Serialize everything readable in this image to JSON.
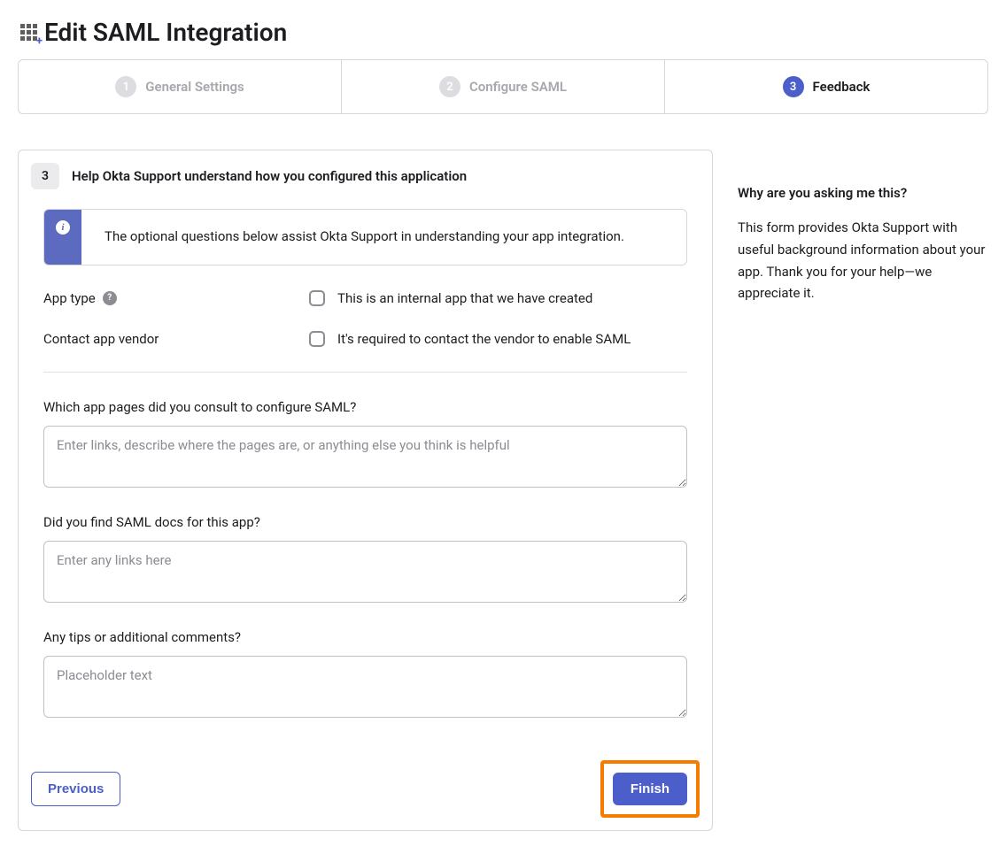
{
  "page": {
    "title": "Edit SAML Integration"
  },
  "wizard": {
    "steps": [
      {
        "num": "1",
        "label": "General Settings"
      },
      {
        "num": "2",
        "label": "Configure SAML"
      },
      {
        "num": "3",
        "label": "Feedback"
      }
    ]
  },
  "section": {
    "num": "3",
    "title": "Help Okta Support understand how you configured this application"
  },
  "info": {
    "text": "The optional questions below assist Okta Support in understanding your app integration."
  },
  "fields": {
    "app_type": {
      "label": "App type",
      "checkbox_label": "This is an internal app that we have created"
    },
    "contact_vendor": {
      "label": "Contact app vendor",
      "checkbox_label": "It's required to contact the vendor to enable SAML"
    },
    "pages_consulted": {
      "label": "Which app pages did you consult to configure SAML?",
      "placeholder": "Enter links, describe where the pages are, or anything else you think is helpful"
    },
    "saml_docs": {
      "label": "Did you find SAML docs for this app?",
      "placeholder": "Enter any links here"
    },
    "tips": {
      "label": "Any tips or additional comments?",
      "placeholder": "Placeholder text"
    }
  },
  "buttons": {
    "previous": "Previous",
    "finish": "Finish"
  },
  "sidebar": {
    "title": "Why are you asking me this?",
    "text": "This form provides Okta Support with useful background information about your app. Thank you for your help—we appreciate it."
  }
}
